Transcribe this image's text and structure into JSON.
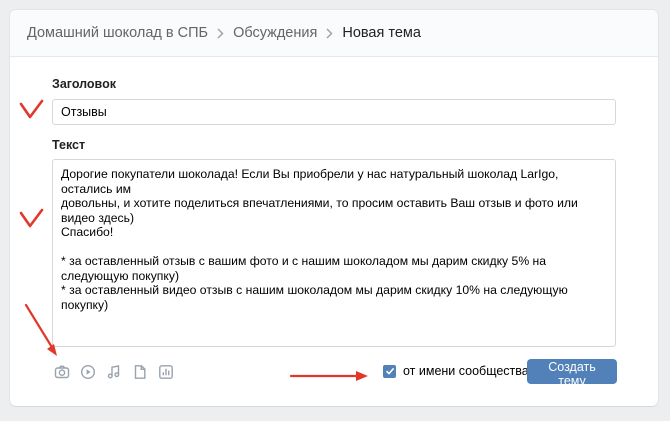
{
  "breadcrumb": {
    "items": [
      "Домашний шоколад в СПБ",
      "Обсуждения"
    ],
    "current": "Новая тема"
  },
  "form": {
    "title_label": "Заголовок",
    "title_value": "Отзывы",
    "text_label": "Текст",
    "text_lines": [
      "Дорогие покупатели шоколада! Если Вы приобрели у нас натуральный шоколад LarIgo, остались им",
      "довольны, и хотите поделиться впечатлениями, то просим оставить Ваш отзыв и фото или видео здесь)",
      "Спасибо!",
      "* за оставленный отзыв с вашим фото и с нашим шоколадом мы дарим скидку 5% на следующую покупку)",
      "* за оставленный видео отзыв с нашим шоколадом мы дарим скидку 10% на следующую покупку)"
    ]
  },
  "attachments": [
    "camera-icon",
    "video-icon",
    "music-icon",
    "document-icon",
    "poll-icon"
  ],
  "footer": {
    "community_checkbox_label": "от имени сообщества",
    "community_checkbox_checked": true,
    "submit_label": "Создать тему"
  },
  "colors": {
    "accent": "#5181b8",
    "annotation": "#e0392b",
    "page_bg": "#edeef0"
  }
}
